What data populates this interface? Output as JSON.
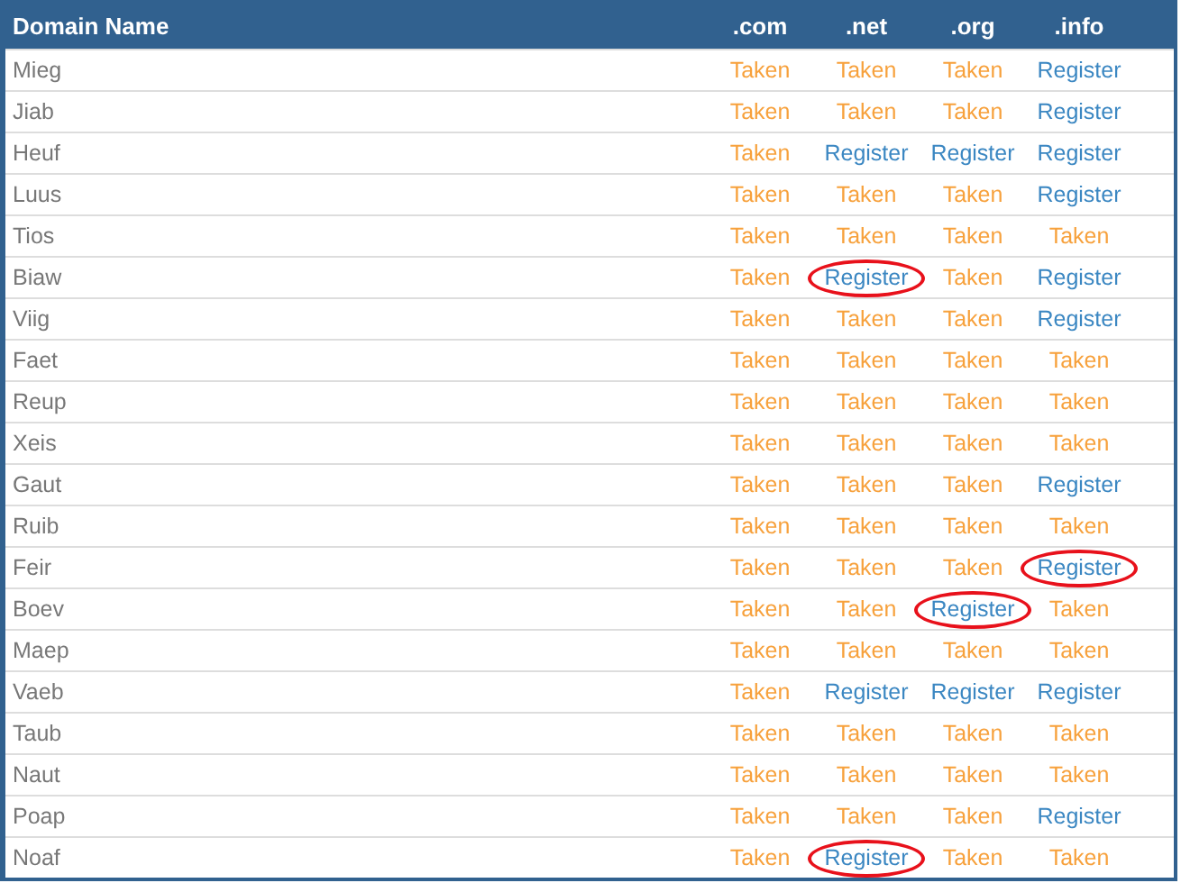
{
  "table": {
    "columns": [
      "Domain Name",
      ".com",
      ".net",
      ".org",
      ".info"
    ],
    "rows": [
      {
        "cells": [
          {
            "text": "Mieg",
            "kind": "name",
            "circled": false
          },
          {
            "text": "Taken",
            "kind": "taken",
            "circled": false
          },
          {
            "text": "Taken",
            "kind": "taken",
            "circled": false
          },
          {
            "text": "Taken",
            "kind": "taken",
            "circled": false
          },
          {
            "text": "Register",
            "kind": "register",
            "circled": false
          }
        ]
      },
      {
        "cells": [
          {
            "text": "Jiab",
            "kind": "name",
            "circled": false
          },
          {
            "text": "Taken",
            "kind": "taken",
            "circled": false
          },
          {
            "text": "Taken",
            "kind": "taken",
            "circled": false
          },
          {
            "text": "Taken",
            "kind": "taken",
            "circled": false
          },
          {
            "text": "Register",
            "kind": "register",
            "circled": false
          }
        ]
      },
      {
        "cells": [
          {
            "text": "Heuf",
            "kind": "name",
            "circled": false
          },
          {
            "text": "Taken",
            "kind": "taken",
            "circled": false
          },
          {
            "text": "Register",
            "kind": "register",
            "circled": false
          },
          {
            "text": "Register",
            "kind": "register",
            "circled": false
          },
          {
            "text": "Register",
            "kind": "register",
            "circled": false
          }
        ]
      },
      {
        "cells": [
          {
            "text": "Luus",
            "kind": "name",
            "circled": false
          },
          {
            "text": "Taken",
            "kind": "taken",
            "circled": false
          },
          {
            "text": "Taken",
            "kind": "taken",
            "circled": false
          },
          {
            "text": "Taken",
            "kind": "taken",
            "circled": false
          },
          {
            "text": "Register",
            "kind": "register",
            "circled": false
          }
        ]
      },
      {
        "cells": [
          {
            "text": "Tios",
            "kind": "name",
            "circled": false
          },
          {
            "text": "Taken",
            "kind": "taken",
            "circled": false
          },
          {
            "text": "Taken",
            "kind": "taken",
            "circled": false
          },
          {
            "text": "Taken",
            "kind": "taken",
            "circled": false
          },
          {
            "text": "Taken",
            "kind": "taken",
            "circled": false
          }
        ]
      },
      {
        "cells": [
          {
            "text": "Biaw",
            "kind": "name",
            "circled": false
          },
          {
            "text": "Taken",
            "kind": "taken",
            "circled": false
          },
          {
            "text": "Register",
            "kind": "register",
            "circled": true
          },
          {
            "text": "Taken",
            "kind": "taken",
            "circled": false
          },
          {
            "text": "Register",
            "kind": "register",
            "circled": false
          }
        ]
      },
      {
        "cells": [
          {
            "text": "Viig",
            "kind": "name",
            "circled": false
          },
          {
            "text": "Taken",
            "kind": "taken",
            "circled": false
          },
          {
            "text": "Taken",
            "kind": "taken",
            "circled": false
          },
          {
            "text": "Taken",
            "kind": "taken",
            "circled": false
          },
          {
            "text": "Register",
            "kind": "register",
            "circled": false
          }
        ]
      },
      {
        "cells": [
          {
            "text": "Faet",
            "kind": "name",
            "circled": false
          },
          {
            "text": "Taken",
            "kind": "taken",
            "circled": false
          },
          {
            "text": "Taken",
            "kind": "taken",
            "circled": false
          },
          {
            "text": "Taken",
            "kind": "taken",
            "circled": false
          },
          {
            "text": "Taken",
            "kind": "taken",
            "circled": false
          }
        ]
      },
      {
        "cells": [
          {
            "text": "Reup",
            "kind": "name",
            "circled": false
          },
          {
            "text": "Taken",
            "kind": "taken",
            "circled": false
          },
          {
            "text": "Taken",
            "kind": "taken",
            "circled": false
          },
          {
            "text": "Taken",
            "kind": "taken",
            "circled": false
          },
          {
            "text": "Taken",
            "kind": "taken",
            "circled": false
          }
        ]
      },
      {
        "cells": [
          {
            "text": "Xeis",
            "kind": "name",
            "circled": false
          },
          {
            "text": "Taken",
            "kind": "taken",
            "circled": false
          },
          {
            "text": "Taken",
            "kind": "taken",
            "circled": false
          },
          {
            "text": "Taken",
            "kind": "taken",
            "circled": false
          },
          {
            "text": "Taken",
            "kind": "taken",
            "circled": false
          }
        ]
      },
      {
        "cells": [
          {
            "text": "Gaut",
            "kind": "name",
            "circled": false
          },
          {
            "text": "Taken",
            "kind": "taken",
            "circled": false
          },
          {
            "text": "Taken",
            "kind": "taken",
            "circled": false
          },
          {
            "text": "Taken",
            "kind": "taken",
            "circled": false
          },
          {
            "text": "Register",
            "kind": "register",
            "circled": false
          }
        ]
      },
      {
        "cells": [
          {
            "text": "Ruib",
            "kind": "name",
            "circled": false
          },
          {
            "text": "Taken",
            "kind": "taken",
            "circled": false
          },
          {
            "text": "Taken",
            "kind": "taken",
            "circled": false
          },
          {
            "text": "Taken",
            "kind": "taken",
            "circled": false
          },
          {
            "text": "Taken",
            "kind": "taken",
            "circled": false
          }
        ]
      },
      {
        "cells": [
          {
            "text": "Feir",
            "kind": "name",
            "circled": false
          },
          {
            "text": "Taken",
            "kind": "taken",
            "circled": false
          },
          {
            "text": "Taken",
            "kind": "taken",
            "circled": false
          },
          {
            "text": "Taken",
            "kind": "taken",
            "circled": false
          },
          {
            "text": "Register",
            "kind": "register",
            "circled": true
          }
        ]
      },
      {
        "cells": [
          {
            "text": "Boev",
            "kind": "name",
            "circled": false
          },
          {
            "text": "Taken",
            "kind": "taken",
            "circled": false
          },
          {
            "text": "Taken",
            "kind": "taken",
            "circled": false
          },
          {
            "text": "Register",
            "kind": "register",
            "circled": true
          },
          {
            "text": "Taken",
            "kind": "taken",
            "circled": false
          }
        ]
      },
      {
        "cells": [
          {
            "text": "Maep",
            "kind": "name",
            "circled": false
          },
          {
            "text": "Taken",
            "kind": "taken",
            "circled": false
          },
          {
            "text": "Taken",
            "kind": "taken",
            "circled": false
          },
          {
            "text": "Taken",
            "kind": "taken",
            "circled": false
          },
          {
            "text": "Taken",
            "kind": "taken",
            "circled": false
          }
        ]
      },
      {
        "cells": [
          {
            "text": "Vaeb",
            "kind": "name",
            "circled": false
          },
          {
            "text": "Taken",
            "kind": "taken",
            "circled": false
          },
          {
            "text": "Register",
            "kind": "register",
            "circled": false
          },
          {
            "text": "Register",
            "kind": "register",
            "circled": false
          },
          {
            "text": "Register",
            "kind": "register",
            "circled": false
          }
        ]
      },
      {
        "cells": [
          {
            "text": "Taub",
            "kind": "name",
            "circled": false
          },
          {
            "text": "Taken",
            "kind": "taken",
            "circled": false
          },
          {
            "text": "Taken",
            "kind": "taken",
            "circled": false
          },
          {
            "text": "Taken",
            "kind": "taken",
            "circled": false
          },
          {
            "text": "Taken",
            "kind": "taken",
            "circled": false
          }
        ]
      },
      {
        "cells": [
          {
            "text": "Naut",
            "kind": "name",
            "circled": false
          },
          {
            "text": "Taken",
            "kind": "taken",
            "circled": false
          },
          {
            "text": "Taken",
            "kind": "taken",
            "circled": false
          },
          {
            "text": "Taken",
            "kind": "taken",
            "circled": false
          },
          {
            "text": "Taken",
            "kind": "taken",
            "circled": false
          }
        ]
      },
      {
        "cells": [
          {
            "text": "Poap",
            "kind": "name",
            "circled": false
          },
          {
            "text": "Taken",
            "kind": "taken",
            "circled": false
          },
          {
            "text": "Taken",
            "kind": "taken",
            "circled": false
          },
          {
            "text": "Taken",
            "kind": "taken",
            "circled": false
          },
          {
            "text": "Register",
            "kind": "register",
            "circled": false
          }
        ]
      },
      {
        "cells": [
          {
            "text": "Noaf",
            "kind": "name",
            "circled": false
          },
          {
            "text": "Taken",
            "kind": "taken",
            "circled": false
          },
          {
            "text": "Register",
            "kind": "register",
            "circled": true
          },
          {
            "text": "Taken",
            "kind": "taken",
            "circled": false
          },
          {
            "text": "Taken",
            "kind": "taken",
            "circled": false
          }
        ]
      }
    ]
  }
}
